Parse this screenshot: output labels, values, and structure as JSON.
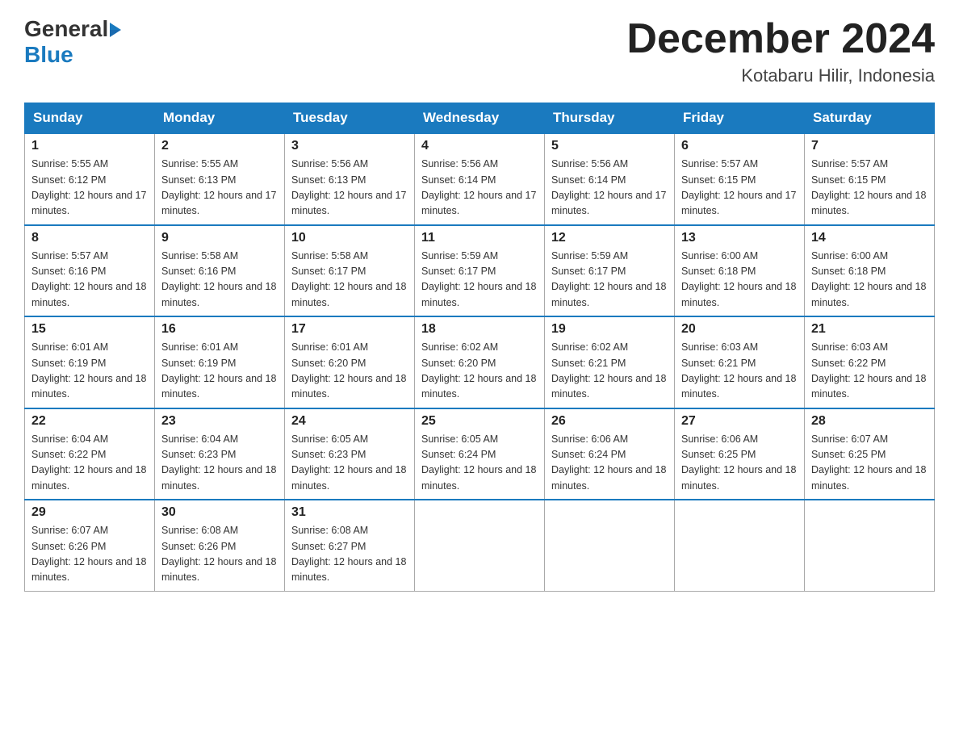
{
  "header": {
    "logo_general": "General",
    "logo_blue": "Blue",
    "month_title": "December 2024",
    "location": "Kotabaru Hilir, Indonesia"
  },
  "days_of_week": [
    "Sunday",
    "Monday",
    "Tuesday",
    "Wednesday",
    "Thursday",
    "Friday",
    "Saturday"
  ],
  "weeks": [
    [
      {
        "day": "1",
        "sunrise": "5:55 AM",
        "sunset": "6:12 PM",
        "daylight": "12 hours and 17 minutes."
      },
      {
        "day": "2",
        "sunrise": "5:55 AM",
        "sunset": "6:13 PM",
        "daylight": "12 hours and 17 minutes."
      },
      {
        "day": "3",
        "sunrise": "5:56 AM",
        "sunset": "6:13 PM",
        "daylight": "12 hours and 17 minutes."
      },
      {
        "day": "4",
        "sunrise": "5:56 AM",
        "sunset": "6:14 PM",
        "daylight": "12 hours and 17 minutes."
      },
      {
        "day": "5",
        "sunrise": "5:56 AM",
        "sunset": "6:14 PM",
        "daylight": "12 hours and 17 minutes."
      },
      {
        "day": "6",
        "sunrise": "5:57 AM",
        "sunset": "6:15 PM",
        "daylight": "12 hours and 17 minutes."
      },
      {
        "day": "7",
        "sunrise": "5:57 AM",
        "sunset": "6:15 PM",
        "daylight": "12 hours and 18 minutes."
      }
    ],
    [
      {
        "day": "8",
        "sunrise": "5:57 AM",
        "sunset": "6:16 PM",
        "daylight": "12 hours and 18 minutes."
      },
      {
        "day": "9",
        "sunrise": "5:58 AM",
        "sunset": "6:16 PM",
        "daylight": "12 hours and 18 minutes."
      },
      {
        "day": "10",
        "sunrise": "5:58 AM",
        "sunset": "6:17 PM",
        "daylight": "12 hours and 18 minutes."
      },
      {
        "day": "11",
        "sunrise": "5:59 AM",
        "sunset": "6:17 PM",
        "daylight": "12 hours and 18 minutes."
      },
      {
        "day": "12",
        "sunrise": "5:59 AM",
        "sunset": "6:17 PM",
        "daylight": "12 hours and 18 minutes."
      },
      {
        "day": "13",
        "sunrise": "6:00 AM",
        "sunset": "6:18 PM",
        "daylight": "12 hours and 18 minutes."
      },
      {
        "day": "14",
        "sunrise": "6:00 AM",
        "sunset": "6:18 PM",
        "daylight": "12 hours and 18 minutes."
      }
    ],
    [
      {
        "day": "15",
        "sunrise": "6:01 AM",
        "sunset": "6:19 PM",
        "daylight": "12 hours and 18 minutes."
      },
      {
        "day": "16",
        "sunrise": "6:01 AM",
        "sunset": "6:19 PM",
        "daylight": "12 hours and 18 minutes."
      },
      {
        "day": "17",
        "sunrise": "6:01 AM",
        "sunset": "6:20 PM",
        "daylight": "12 hours and 18 minutes."
      },
      {
        "day": "18",
        "sunrise": "6:02 AM",
        "sunset": "6:20 PM",
        "daylight": "12 hours and 18 minutes."
      },
      {
        "day": "19",
        "sunrise": "6:02 AM",
        "sunset": "6:21 PM",
        "daylight": "12 hours and 18 minutes."
      },
      {
        "day": "20",
        "sunrise": "6:03 AM",
        "sunset": "6:21 PM",
        "daylight": "12 hours and 18 minutes."
      },
      {
        "day": "21",
        "sunrise": "6:03 AM",
        "sunset": "6:22 PM",
        "daylight": "12 hours and 18 minutes."
      }
    ],
    [
      {
        "day": "22",
        "sunrise": "6:04 AM",
        "sunset": "6:22 PM",
        "daylight": "12 hours and 18 minutes."
      },
      {
        "day": "23",
        "sunrise": "6:04 AM",
        "sunset": "6:23 PM",
        "daylight": "12 hours and 18 minutes."
      },
      {
        "day": "24",
        "sunrise": "6:05 AM",
        "sunset": "6:23 PM",
        "daylight": "12 hours and 18 minutes."
      },
      {
        "day": "25",
        "sunrise": "6:05 AM",
        "sunset": "6:24 PM",
        "daylight": "12 hours and 18 minutes."
      },
      {
        "day": "26",
        "sunrise": "6:06 AM",
        "sunset": "6:24 PM",
        "daylight": "12 hours and 18 minutes."
      },
      {
        "day": "27",
        "sunrise": "6:06 AM",
        "sunset": "6:25 PM",
        "daylight": "12 hours and 18 minutes."
      },
      {
        "day": "28",
        "sunrise": "6:07 AM",
        "sunset": "6:25 PM",
        "daylight": "12 hours and 18 minutes."
      }
    ],
    [
      {
        "day": "29",
        "sunrise": "6:07 AM",
        "sunset": "6:26 PM",
        "daylight": "12 hours and 18 minutes."
      },
      {
        "day": "30",
        "sunrise": "6:08 AM",
        "sunset": "6:26 PM",
        "daylight": "12 hours and 18 minutes."
      },
      {
        "day": "31",
        "sunrise": "6:08 AM",
        "sunset": "6:27 PM",
        "daylight": "12 hours and 18 minutes."
      },
      null,
      null,
      null,
      null
    ]
  ]
}
